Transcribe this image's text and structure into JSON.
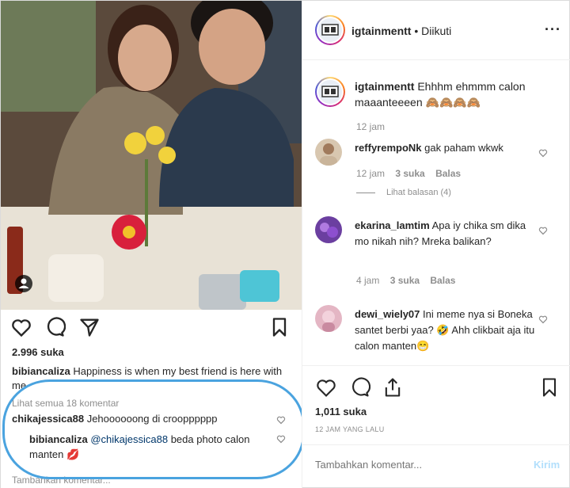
{
  "left": {
    "likes": "2.996 suka",
    "caption": {
      "user": "bibiancaliza",
      "text": "Happiness is when my best friend is here with me"
    },
    "view_all": "Lihat semua 18 komentar",
    "comment1": {
      "user": "chikajessica88",
      "text": "Jehoooooong di croopppppp"
    },
    "comment2": {
      "user": "bibiancaliza",
      "mention": "@chikajessica88",
      "text": "beda photo calon manten 💋"
    },
    "add_comment": "Tambahkan komentar..."
  },
  "right": {
    "header": {
      "username": "igtainmentt",
      "follow_status": "• Diikuti"
    },
    "post": {
      "user": "igtainmentt",
      "caption": "Ehhhm ehmmm calon maaanteeeen 🙈🙈🙈🙈",
      "time": "12 jam"
    },
    "comments": [
      {
        "user": "reffyrempoNk",
        "text": "gak paham wkwk",
        "time": "12 jam",
        "likes": "3 suka",
        "reply": "Balas",
        "view_replies": "Lihat balasan (4)"
      },
      {
        "user": "ekarina_lamtim",
        "text": "Apa iy chika sm dika mo nikah nih? Mreka balikan?",
        "time": "4 jam",
        "likes": "3 suka",
        "reply": "Balas"
      },
      {
        "user": "dewi_wiely07",
        "text": "Ini meme nya si Boneka santet berbi yaa? 🤣 Ahh clikbait aja itu calon manten😁"
      }
    ],
    "likes": "1,011 suka",
    "timestamp": "12 JAM YANG LALU",
    "add_comment_placeholder": "Tambahkan komentar...",
    "post_button": "Kirim"
  },
  "colors": {
    "annotation_oval": "#4aa3df",
    "link": "#00376b",
    "muted": "#8e8e8e",
    "post_button": "#b2dffc"
  },
  "icons": [
    "heart-icon",
    "comment-icon",
    "share-icon",
    "bookmark-icon",
    "more-options-icon",
    "profile-tag-icon"
  ]
}
